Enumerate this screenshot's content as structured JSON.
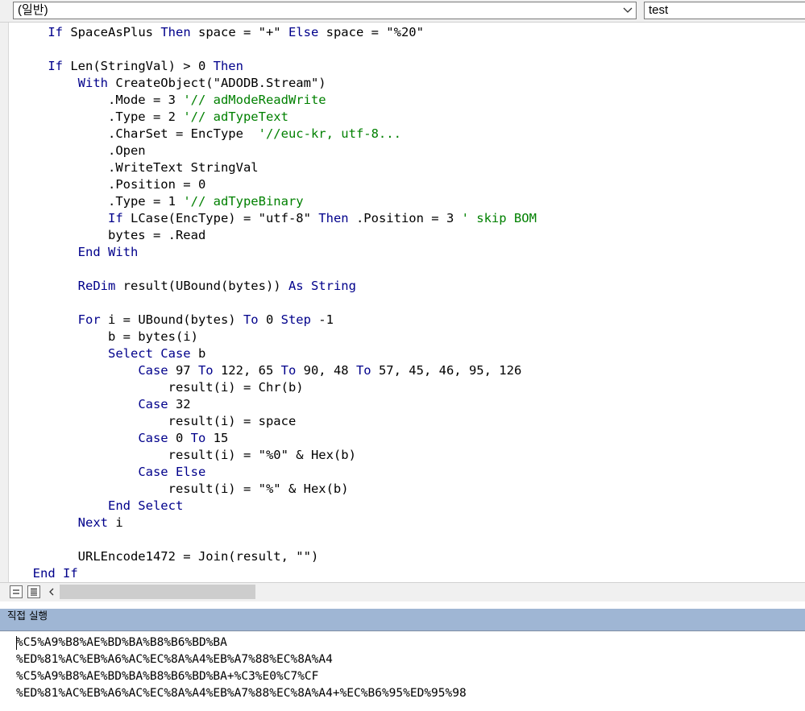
{
  "toolbar": {
    "object_combo": "(일반)",
    "procedure_combo": "test"
  },
  "code": {
    "lines": [
      [
        {
          "t": "    "
        },
        {
          "t": "If",
          "k": "kw"
        },
        {
          "t": " SpaceAsPlus "
        },
        {
          "t": "Then",
          "k": "kw"
        },
        {
          "t": " space = \"+\" "
        },
        {
          "t": "Else",
          "k": "kw"
        },
        {
          "t": " space = \"%20\""
        }
      ],
      [],
      [
        {
          "t": "    "
        },
        {
          "t": "If",
          "k": "kw"
        },
        {
          "t": " Len(StringVal) > 0 "
        },
        {
          "t": "Then",
          "k": "kw"
        }
      ],
      [
        {
          "t": "        "
        },
        {
          "t": "With",
          "k": "kw"
        },
        {
          "t": " CreateObject(\"ADODB.Stream\")"
        }
      ],
      [
        {
          "t": "            .Mode = 3 "
        },
        {
          "t": "'// adModeReadWrite",
          "k": "cm"
        }
      ],
      [
        {
          "t": "            .Type = 2 "
        },
        {
          "t": "'// adTypeText",
          "k": "cm"
        }
      ],
      [
        {
          "t": "            .CharSet = EncType  "
        },
        {
          "t": "'//euc-kr, utf-8...",
          "k": "cm"
        }
      ],
      [
        {
          "t": "            .Open"
        }
      ],
      [
        {
          "t": "            .WriteText StringVal"
        }
      ],
      [
        {
          "t": "            .Position = 0"
        }
      ],
      [
        {
          "t": "            .Type = 1 "
        },
        {
          "t": "'// adTypeBinary",
          "k": "cm"
        }
      ],
      [
        {
          "t": "            "
        },
        {
          "t": "If",
          "k": "kw"
        },
        {
          "t": " LCase(EncType) = \"utf-8\" "
        },
        {
          "t": "Then",
          "k": "kw"
        },
        {
          "t": " .Position = 3 "
        },
        {
          "t": "' skip BOM",
          "k": "cm"
        }
      ],
      [
        {
          "t": "            bytes = .Read"
        }
      ],
      [
        {
          "t": "        "
        },
        {
          "t": "End With",
          "k": "kw"
        }
      ],
      [],
      [
        {
          "t": "        "
        },
        {
          "t": "ReDim",
          "k": "kw"
        },
        {
          "t": " result(UBound(bytes)) "
        },
        {
          "t": "As String",
          "k": "kw"
        }
      ],
      [],
      [
        {
          "t": "        "
        },
        {
          "t": "For",
          "k": "kw"
        },
        {
          "t": " i = UBound(bytes) "
        },
        {
          "t": "To",
          "k": "kw"
        },
        {
          "t": " 0 "
        },
        {
          "t": "Step",
          "k": "kw"
        },
        {
          "t": " -1"
        }
      ],
      [
        {
          "t": "            b = bytes(i)"
        }
      ],
      [
        {
          "t": "            "
        },
        {
          "t": "Select Case",
          "k": "kw"
        },
        {
          "t": " b"
        }
      ],
      [
        {
          "t": "                "
        },
        {
          "t": "Case",
          "k": "kw"
        },
        {
          "t": " 97 "
        },
        {
          "t": "To",
          "k": "kw"
        },
        {
          "t": " 122, 65 "
        },
        {
          "t": "To",
          "k": "kw"
        },
        {
          "t": " 90, 48 "
        },
        {
          "t": "To",
          "k": "kw"
        },
        {
          "t": " 57, 45, 46, 95, 126"
        }
      ],
      [
        {
          "t": "                    result(i) = Chr(b)"
        }
      ],
      [
        {
          "t": "                "
        },
        {
          "t": "Case",
          "k": "kw"
        },
        {
          "t": " 32"
        }
      ],
      [
        {
          "t": "                    result(i) = space"
        }
      ],
      [
        {
          "t": "                "
        },
        {
          "t": "Case",
          "k": "kw"
        },
        {
          "t": " 0 "
        },
        {
          "t": "To",
          "k": "kw"
        },
        {
          "t": " 15"
        }
      ],
      [
        {
          "t": "                    result(i) = \"%0\" & Hex(b)"
        }
      ],
      [
        {
          "t": "                "
        },
        {
          "t": "Case Else",
          "k": "kw"
        }
      ],
      [
        {
          "t": "                    result(i) = \"%\" & Hex(b)"
        }
      ],
      [
        {
          "t": "            "
        },
        {
          "t": "End Select",
          "k": "kw"
        }
      ],
      [
        {
          "t": "        "
        },
        {
          "t": "Next",
          "k": "kw"
        },
        {
          "t": " i"
        }
      ],
      [],
      [
        {
          "t": "        URLEncode1472 = Join(result, \"\")"
        }
      ],
      [
        {
          "t": "  "
        },
        {
          "t": "End If",
          "k": "kw"
        }
      ]
    ]
  },
  "immediate": {
    "title": "직접 실행",
    "lines": [
      "%C5%A9%B8%AE%BD%BA%B8%B6%BD%BA",
      "%ED%81%AC%EB%A6%AC%EC%8A%A4%EB%A7%88%EC%8A%A4",
      "%C5%A9%B8%AE%BD%BA%B8%B6%BD%BA+%C3%E0%C7%CF",
      "%ED%81%AC%EB%A6%AC%EC%8A%A4%EB%A7%88%EC%8A%A4+%EC%B6%95%ED%95%98"
    ]
  },
  "colors": {
    "keyword": "#00008b",
    "comment": "#008000",
    "immediate_header": "#9fb6d4"
  }
}
